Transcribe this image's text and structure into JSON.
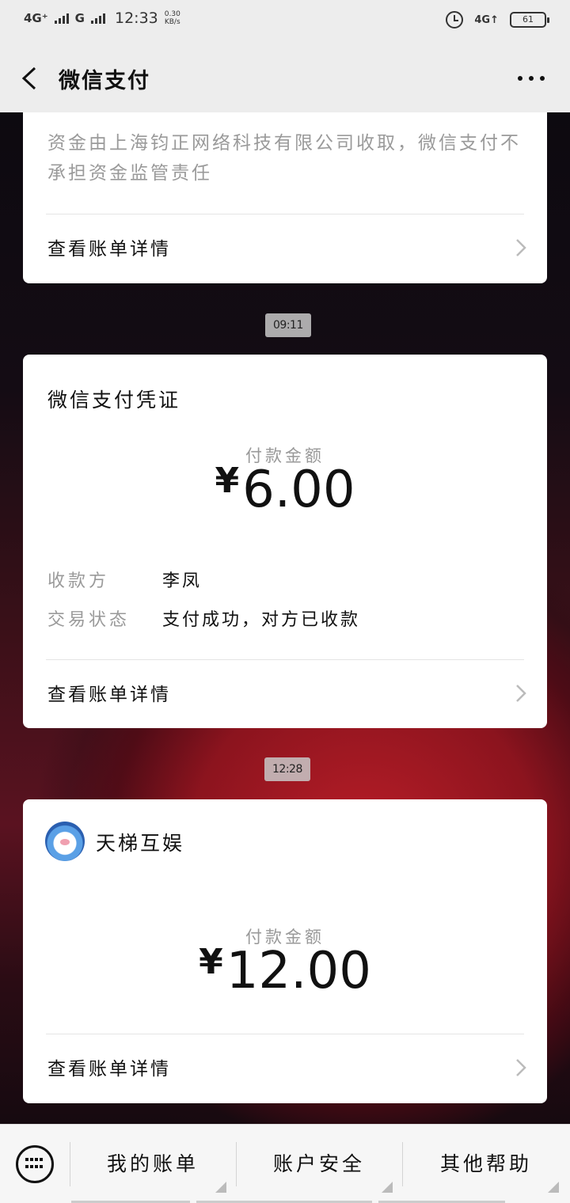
{
  "status_bar": {
    "network1": "4G⁺",
    "network2": "G",
    "time": "12:33",
    "speed_value": "0.30",
    "speed_unit": "KB/s",
    "network3": "4G↑",
    "battery": "61"
  },
  "nav": {
    "title": "微信支付"
  },
  "cards": [
    {
      "note": "资金由上海钧正网络科技有限公司收取，微信支付不承担资金监管责任",
      "detail_label": "查看账单详情"
    },
    {
      "time": "09:11",
      "title": "微信支付凭证",
      "amount_label": "付款金额",
      "currency": "¥",
      "amount": "6.00",
      "payee_label": "收款方",
      "payee": "李凤",
      "status_label": "交易状态",
      "status": "支付成功，对方已收款",
      "detail_label": "查看账单详情"
    },
    {
      "time": "12:28",
      "merchant": "天梯互娱",
      "amount_label": "付款金额",
      "currency": "¥",
      "amount": "12.00",
      "detail_label": "查看账单详情"
    }
  ],
  "bottom_menu": {
    "items": [
      "我的账单",
      "账户安全",
      "其他帮助"
    ]
  }
}
